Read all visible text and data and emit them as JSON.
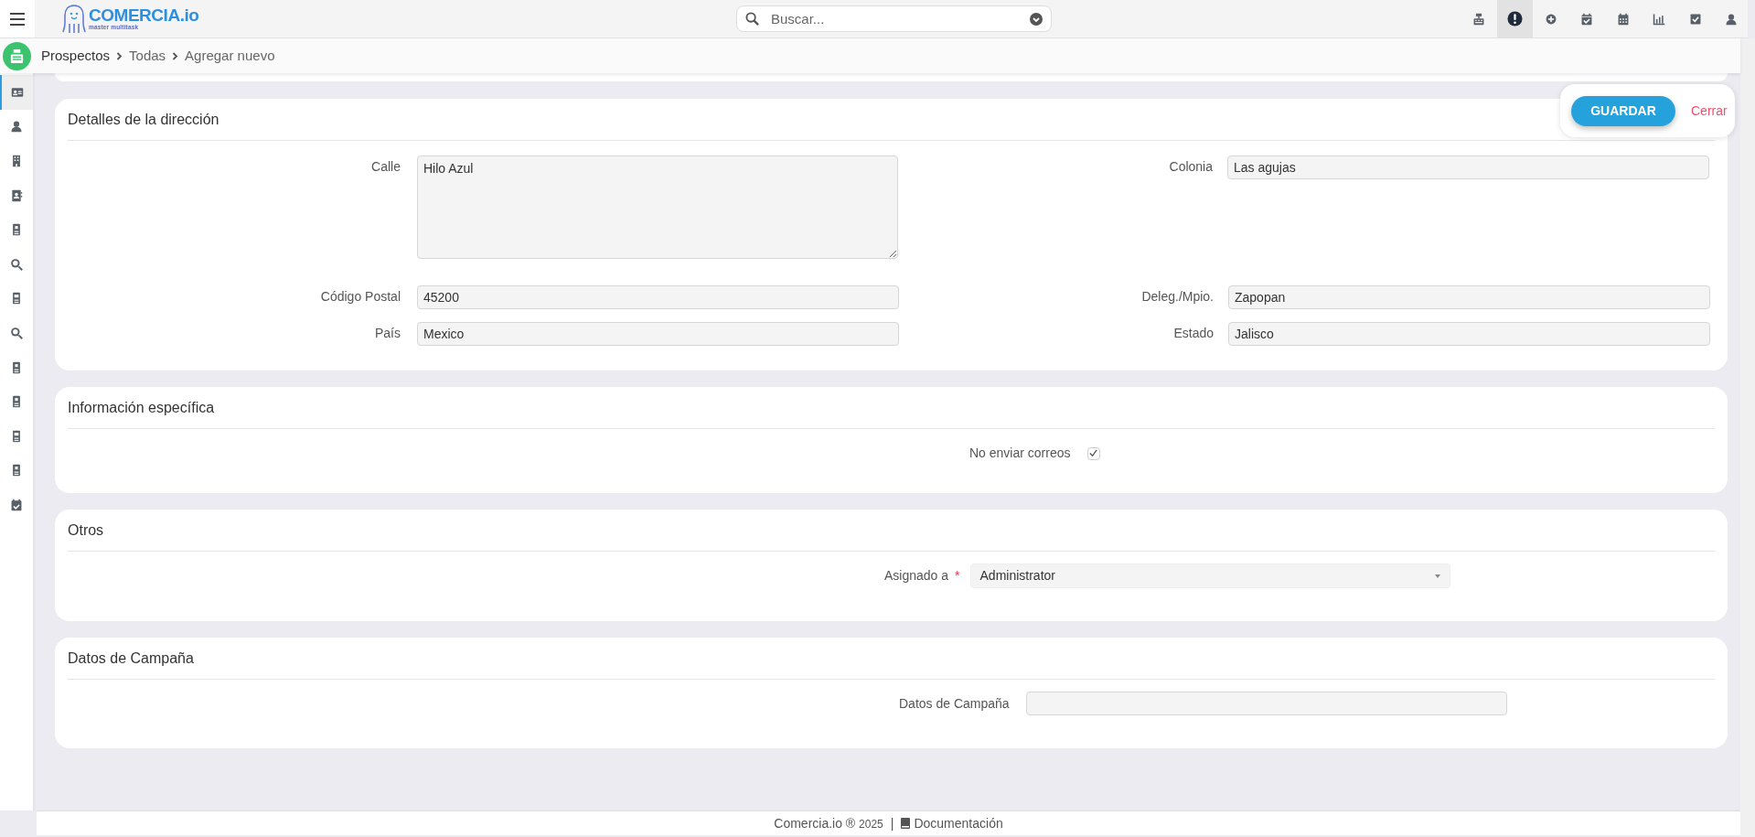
{
  "header": {
    "logo_title": "COMERCIA.io",
    "logo_tagline": "master multitask",
    "search": {
      "placeholder": "Buscar..."
    },
    "toolbar": [
      {
        "selected": false
      },
      {
        "selected": true
      },
      {
        "selected": false
      },
      {
        "selected": false
      },
      {
        "selected": false
      },
      {
        "selected": false
      },
      {
        "selected": false
      },
      {
        "selected": false
      }
    ]
  },
  "breadcrumb": [
    "Prospectos",
    "Todas",
    "Agregar nuevo"
  ],
  "sidebar": {
    "items": [
      {
        "selected": true
      },
      {
        "selected": false
      },
      {
        "selected": false
      },
      {
        "selected": false
      },
      {
        "selected": false
      },
      {
        "selected": false
      },
      {
        "selected": false
      },
      {
        "selected": false
      },
      {
        "selected": false
      },
      {
        "selected": false
      },
      {
        "selected": false
      },
      {
        "selected": false
      },
      {
        "selected": false
      }
    ]
  },
  "actions": {
    "save": "GUARDAR",
    "close": "Cerrar"
  },
  "address": {
    "title": "Detalles de la dirección",
    "rows": [
      {
        "left": {
          "label": "Calle",
          "value": "Hilo Azul",
          "kind": "textarea"
        },
        "right": {
          "label": "Colonia",
          "value": "Las agujas",
          "kind": "input"
        }
      },
      {
        "left": {
          "label": "Código Postal",
          "value": "45200",
          "kind": "input"
        },
        "right": {
          "label": "Deleg./Mpio.",
          "value": "Zapopan",
          "kind": "input"
        }
      },
      {
        "left": {
          "label": "País",
          "value": "Mexico",
          "kind": "input"
        },
        "right": {
          "label": "Estado",
          "value": "Jalisco",
          "kind": "input"
        }
      }
    ]
  },
  "specific": {
    "title": "Información específica",
    "checkbox": {
      "label": "No enviar correos",
      "checked": true
    }
  },
  "others": {
    "title": "Otros",
    "assigned": {
      "label": "Asignado a",
      "required": true,
      "required_mark": "*",
      "value": "Administrator"
    }
  },
  "campaign": {
    "title": "Datos de Campaña",
    "field": {
      "label": "Datos de Campaña"
    }
  },
  "footer": {
    "brand": "Comercia.io ®",
    "year": "2025",
    "separator": "|",
    "link": "Documentación"
  }
}
